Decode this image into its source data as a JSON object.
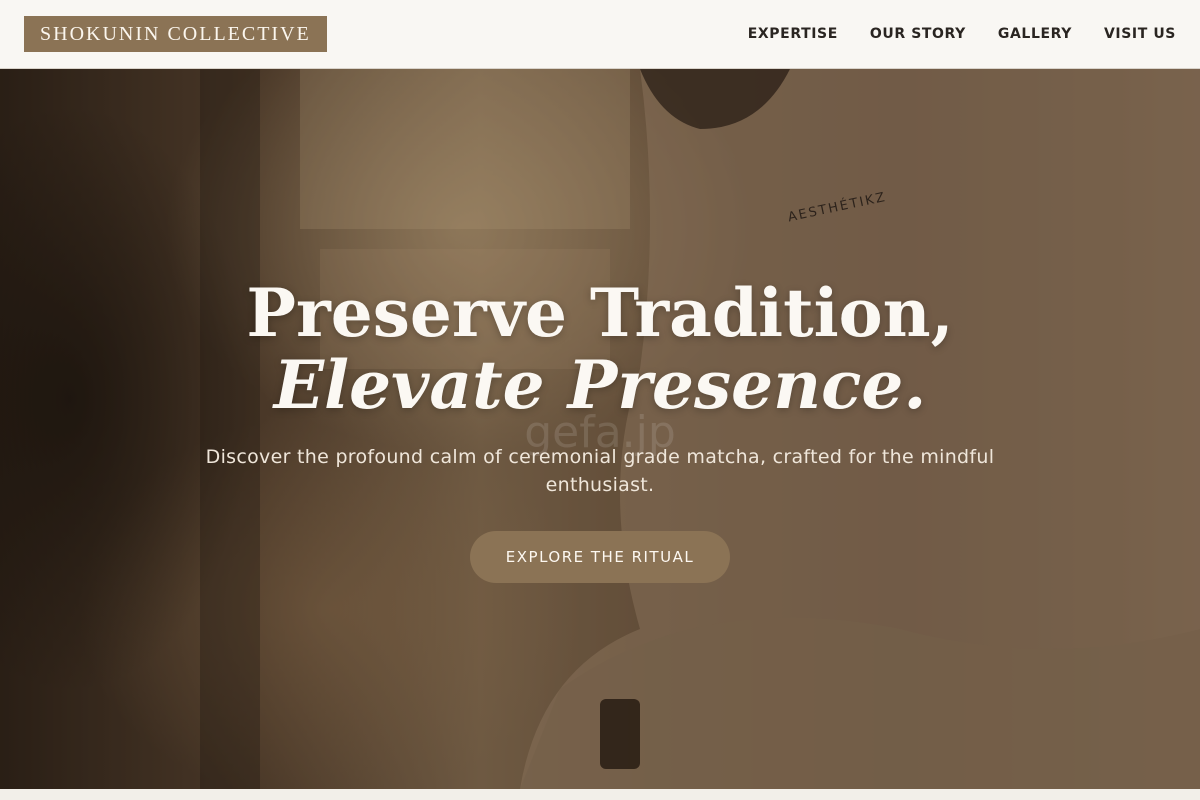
{
  "header": {
    "logo": "SHOKUNIN COLLECTIVE",
    "nav": [
      {
        "label": "EXPERTISE"
      },
      {
        "label": "OUR STORY"
      },
      {
        "label": "GALLERY"
      },
      {
        "label": "VISIT US"
      }
    ]
  },
  "hero": {
    "headline_line1": "Preserve Tradition,",
    "headline_line2": "Elevate Presence.",
    "subtitle": "Discover the profound calm of ceremonial grade matcha, crafted for the mindful enthusiast.",
    "cta_label": "EXPLORE THE RITUAL",
    "watermark": "gefa.jp",
    "sweatshirt_print": "AESTHÉTIKZ"
  },
  "colors": {
    "accent": "#8b7355",
    "header_bg": "#f9f7f3",
    "text_dark": "#2a2521"
  }
}
